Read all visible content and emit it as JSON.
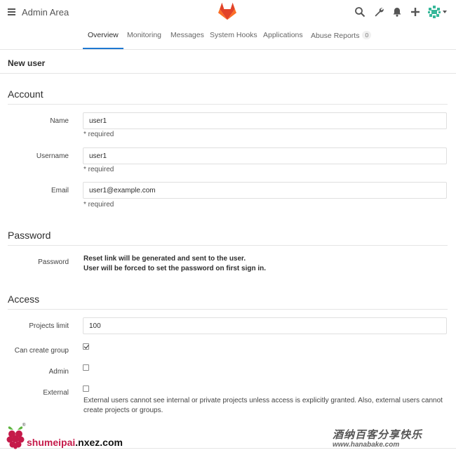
{
  "header": {
    "title": "Admin Area",
    "menu_icon": "hamburger-icon",
    "logo_icon": "gitlab-logo",
    "icons": [
      "search-icon",
      "wrench-icon",
      "bell-icon",
      "plus-icon",
      "avatar",
      "chevron-down-icon"
    ]
  },
  "nav": {
    "tabs": [
      {
        "label": "Overview",
        "active": true
      },
      {
        "label": "Monitoring"
      },
      {
        "label": "Messages"
      },
      {
        "label": "System Hooks"
      },
      {
        "label": "Applications"
      },
      {
        "label": "Abuse Reports",
        "badge": "0"
      }
    ]
  },
  "page": {
    "title": "New user"
  },
  "account": {
    "heading": "Account",
    "name": {
      "label": "Name",
      "value": "user1",
      "hint": "* required"
    },
    "username": {
      "label": "Username",
      "value": "user1",
      "hint": "* required"
    },
    "email": {
      "label": "Email",
      "value": "user1@example.com",
      "hint": "* required"
    }
  },
  "password": {
    "heading": "Password",
    "label": "Password",
    "line1": "Reset link will be generated and sent to the user.",
    "line2": "User will be forced to set the password on first sign in."
  },
  "access": {
    "heading": "Access",
    "projects_limit": {
      "label": "Projects limit",
      "value": "100"
    },
    "can_create_group": {
      "label": "Can create group",
      "checked": true
    },
    "admin": {
      "label": "Admin",
      "checked": false
    },
    "external": {
      "label": "External",
      "checked": false,
      "help": "External users cannot see internal or private projects unless access is explicitly granted. Also, external users cannot create projects or groups."
    }
  },
  "watermarks": {
    "left_prefix": "shumeipai",
    "left_suffix": ".nxez.com",
    "left_reg": "®",
    "right_top": "酒纳百客分享快乐",
    "right_sub": "www.hanabake.com"
  },
  "colors": {
    "accent": "#1f78d1",
    "logo_orange": "#fc6d26",
    "logo_red": "#e24329",
    "logo_light": "#fca326",
    "raspberry": "#c51a4a"
  }
}
